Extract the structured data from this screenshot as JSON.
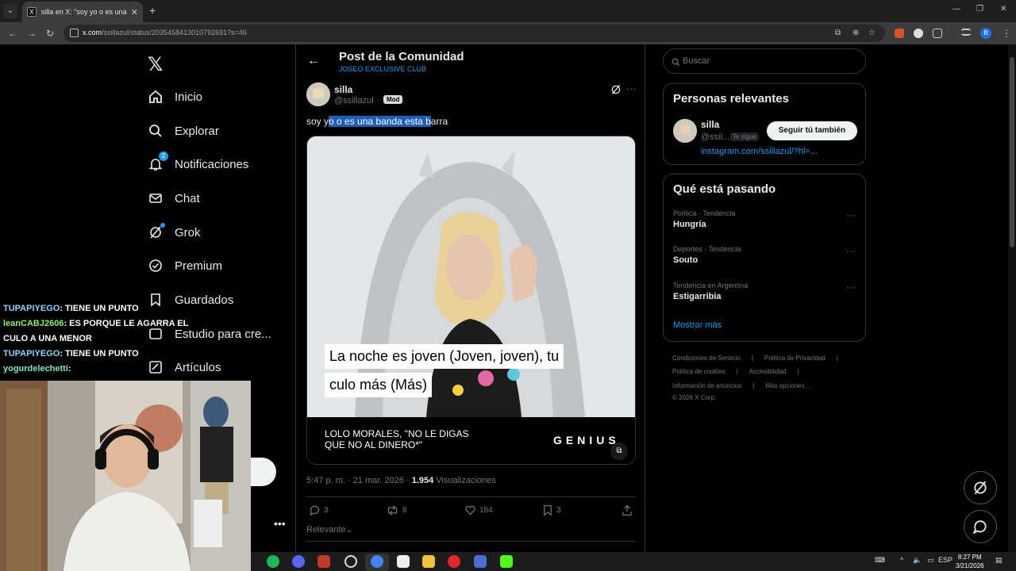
{
  "browser": {
    "tab_title": "silla en X: \"soy yo o es una banda",
    "url_domain": "x.com",
    "url_path": "/ssillazul/status/2035458413010792691?s=46"
  },
  "sidebar": {
    "logo": "𝕏",
    "items": [
      {
        "label": "Inicio"
      },
      {
        "label": "Explorar"
      },
      {
        "label": "Notificaciones",
        "badge": "2"
      },
      {
        "label": "Chat"
      },
      {
        "label": "Grok"
      },
      {
        "label": "Premium"
      },
      {
        "label": "Guardados"
      },
      {
        "label": "Estudio para cre..."
      },
      {
        "label": "Artículos"
      }
    ]
  },
  "stream_chat": [
    {
      "user": "TUPAPIYEGO",
      "msg": ": TIENE UN PUNTO"
    },
    {
      "user": "leanCABJ2606",
      "msg": ": ES PORQUE LE AGARRA EL CULO A UNA MENOR"
    },
    {
      "user": "TUPAPIYEGO",
      "msg": ": TIENE UN PUNTO"
    },
    {
      "user": "yogurdelechetti",
      "msg": ":"
    }
  ],
  "header": {
    "title": "Post de la Comunidad",
    "community": "JOSEO EXCLUSIVE CLUB"
  },
  "post": {
    "author_name": "silla",
    "author_handle": "@ssillazul",
    "dot": "·",
    "mod_badge": "Mod",
    "text_before": "soy y",
    "text_selected": "o o es una banda esta b",
    "text_after": "arra",
    "lyric_line1": "La noche es joven (Joven, joven), tu",
    "lyric_line2": "culo más (Más)",
    "caption": "LOLO MORALES, \"NO LE DIGAS QUE NO AL DINERO*\"",
    "watermark": "GENIUS",
    "time": "5:47 p. m. · 21 mar. 2026 ·",
    "views": "1.954",
    "views_label": "Visualizaciones",
    "replies": "3",
    "reposts": "8",
    "likes": "184",
    "bookmarks": "3",
    "sort_label": "Relevante"
  },
  "search": {
    "placeholder": "Buscar"
  },
  "relevant": {
    "title": "Personas relevantes",
    "name": "silla",
    "handle": "@ssil...",
    "follows_you": "Te sigue",
    "follow_button": "Seguir tú también",
    "link": "instagram.com/ssillazul/?hl=..."
  },
  "trends": {
    "title": "Qué está pasando",
    "items": [
      {
        "category": "Política · Tendencia",
        "name": "Hungría"
      },
      {
        "category": "Deportes · Tendencia",
        "name": "Souto"
      },
      {
        "category": "Tendencia en Argentina",
        "name": "Estigarribia"
      }
    ],
    "show_more": "Mostrar más"
  },
  "footer": {
    "row1": [
      "Condiciones de Servicio",
      "|",
      "Política de Privacidad",
      "|"
    ],
    "row2": [
      "Política de cookies",
      "|",
      "Accesibilidad",
      "|"
    ],
    "row3": [
      "Información de anuncios",
      "|",
      "Más opciones ..."
    ],
    "copyright": "© 2026 X Corp."
  },
  "taskbar": {
    "lang": "ESP",
    "time": "8:27 PM",
    "date": "3/21/2026"
  },
  "colors": {
    "accent": "#1d9bf0",
    "background": "#000000",
    "border": "#2f3336",
    "muted": "#71767b"
  }
}
